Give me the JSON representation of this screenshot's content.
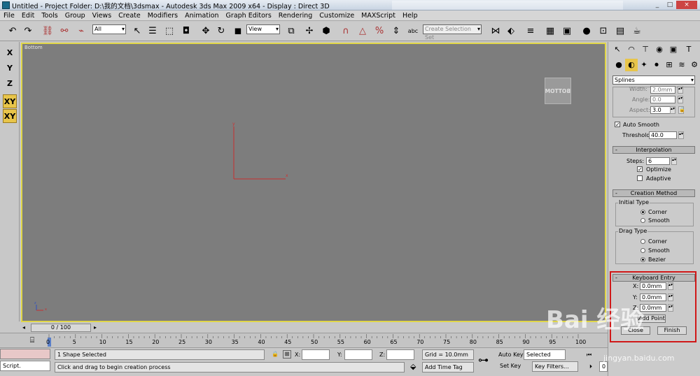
{
  "window": {
    "title": "Untitled     - Project Folder: D:\\我的文档\\3dsmax     - Autodesk 3ds Max  2009 x64     - Display : Direct 3D",
    "controls": [
      "_",
      "□",
      "×"
    ]
  },
  "menu": [
    "File",
    "Edit",
    "Tools",
    "Group",
    "Views",
    "Create",
    "Modifiers",
    "Animation",
    "Graph Editors",
    "Rendering",
    "Customize",
    "MAXScript",
    "Help"
  ],
  "toolbar": {
    "selection_filter": "All",
    "ref_coord": "View",
    "named_selection_placeholder": "Create Selection Set"
  },
  "axis_constraints": [
    {
      "label": "X",
      "active": false
    },
    {
      "label": "Y",
      "active": false
    },
    {
      "label": "Z",
      "active": false
    },
    {
      "label": "XY",
      "active": true
    },
    {
      "label": "XY",
      "active": true
    }
  ],
  "viewport": {
    "label": "Bottom",
    "viewcube": "BOTTOM",
    "gizmo_x": "x",
    "gizmo_y": "y"
  },
  "command_panel": {
    "category_dropdown": "Splines",
    "rendering": {
      "width_label": "Width:",
      "width_value": "2.0mm",
      "angle_label": "Angle:",
      "angle_value": "0.0",
      "aspect_label": "Aspect:",
      "aspect_value": "3.0"
    },
    "auto_smooth": {
      "label": "Auto Smooth",
      "checked": true
    },
    "threshold": {
      "label": "Threshold:",
      "value": "40.0"
    },
    "interpolation": {
      "header": "Interpolation",
      "steps_label": "Steps:",
      "steps_value": "6",
      "optimize": {
        "label": "Optimize",
        "checked": true
      },
      "adaptive": {
        "label": "Adaptive",
        "checked": false
      }
    },
    "creation_method": {
      "header": "Creation Method",
      "initial_type_label": "Initial Type",
      "initial_options": [
        {
          "label": "Corner",
          "selected": true
        },
        {
          "label": "Smooth",
          "selected": false
        }
      ],
      "drag_type_label": "Drag Type",
      "drag_options": [
        {
          "label": "Corner",
          "selected": false
        },
        {
          "label": "Smooth",
          "selected": false
        },
        {
          "label": "Bezier",
          "selected": true
        }
      ]
    },
    "keyboard_entry": {
      "header": "Keyboard Entry",
      "x_label": "X:",
      "x_value": "0.0mm",
      "y_label": "Y:",
      "y_value": "0.0mm",
      "z_label": "Z:",
      "z_value": "0.0mm",
      "add_point": "Add Point",
      "close": "Close",
      "finish": "Finish"
    }
  },
  "timeline": {
    "slider": "0 / 100",
    "ticks": [
      "0",
      "5",
      "10",
      "15",
      "20",
      "25",
      "30",
      "35",
      "40",
      "45",
      "50",
      "55",
      "60",
      "65",
      "70",
      "75",
      "80",
      "85",
      "90",
      "95",
      "100"
    ]
  },
  "status": {
    "script_label": "Script.",
    "selection": "1 Shape Selected",
    "prompt": "Click and drag to begin creation process",
    "x_label": "X:",
    "y_label": "Y:",
    "z_label": "Z:",
    "grid": "Grid = 10.0mm",
    "add_time_tag": "Add Time Tag",
    "auto_key": "Auto Key",
    "selected": "Selected",
    "set_key": "Set Key",
    "key_filters": "Key Filters...",
    "frame": "0"
  },
  "watermark": {
    "brand": "Bai 经验",
    "url": "jingyan.baidu.com"
  },
  "colors": {
    "viewport_bg": "#7d7d7d",
    "active_border": "#e0d648",
    "highlight_box": "#d01818",
    "axis_active": "#e8c54a"
  }
}
